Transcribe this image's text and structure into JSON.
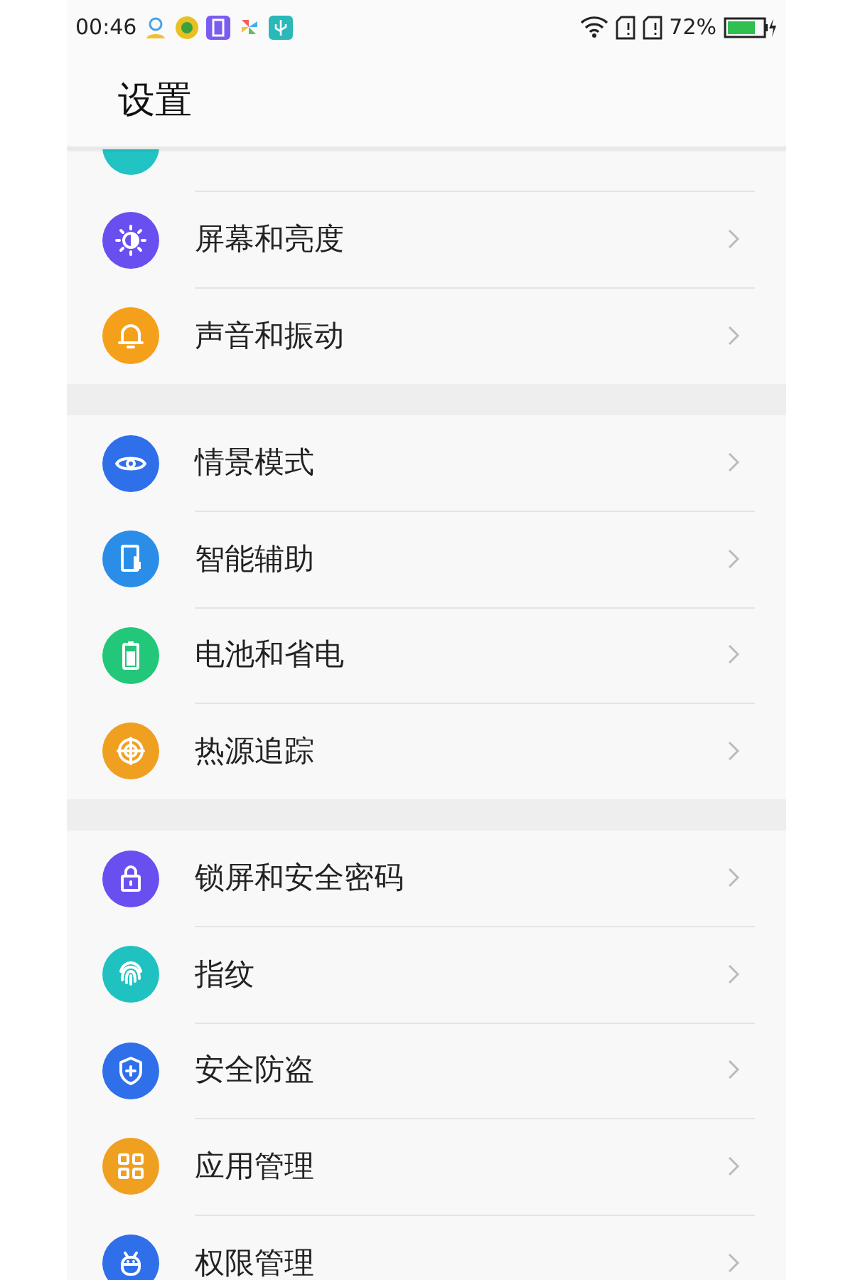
{
  "status_bar": {
    "time": "00:46",
    "battery": "72%"
  },
  "title": "设置",
  "partial_item": {
    "color": "#22c3c3"
  },
  "groups": [
    {
      "items": [
        {
          "label": "屏幕和亮度",
          "color": "#6a4ff0"
        },
        {
          "label": "声音和振动",
          "color": "#f5a01a"
        }
      ]
    },
    {
      "items": [
        {
          "label": "情景模式",
          "color": "#2f6fea"
        },
        {
          "label": "智能辅助",
          "color": "#2a8ee8"
        },
        {
          "label": "电池和省电",
          "color": "#22c77a"
        },
        {
          "label": "热源追踪",
          "color": "#f0a020"
        }
      ]
    },
    {
      "items": [
        {
          "label": "锁屏和安全密码",
          "color": "#6a4ff0"
        },
        {
          "label": "指纹",
          "color": "#1fc2c0"
        },
        {
          "label": "安全防盗",
          "color": "#2f6fea"
        },
        {
          "label": "应用管理",
          "color": "#f0a020"
        },
        {
          "label": "权限管理",
          "color": "#2f6fea"
        }
      ]
    }
  ]
}
